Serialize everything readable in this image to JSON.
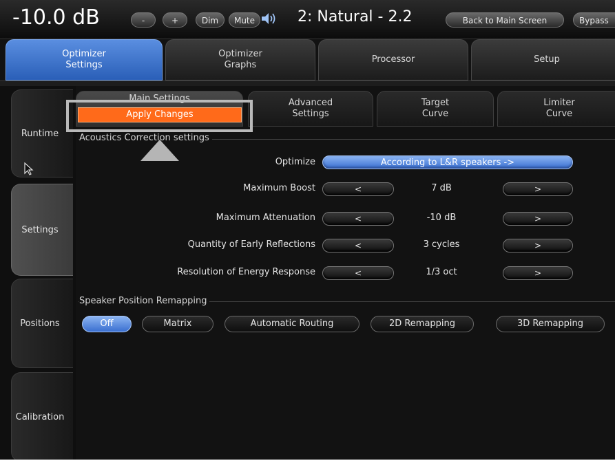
{
  "topbar": {
    "volume": "-10.0 dB",
    "minus_label": "-",
    "plus_label": "+",
    "dim_label": "Dim",
    "mute_label": "Mute",
    "speaker_icon": "speaker-volume-icon",
    "preset": "2: Natural - 2.2",
    "back_label": "Back to Main Screen",
    "bypass_label": "Bypass"
  },
  "tabs": [
    {
      "line1": "Optimizer",
      "line2": "Settings",
      "active": true
    },
    {
      "line1": "Optimizer",
      "line2": "Graphs"
    },
    {
      "line1": "Processor",
      "line2": ""
    },
    {
      "line1": "Setup",
      "line2": ""
    }
  ],
  "sidebar": {
    "items": [
      {
        "label": "Runtime"
      },
      {
        "label": "Settings",
        "active": true
      },
      {
        "label": "Positions"
      },
      {
        "label": "Calibration"
      }
    ]
  },
  "subtabs": [
    {
      "line1": "Main Settings",
      "line2": "",
      "active": true
    },
    {
      "line1": "Advanced",
      "line2": "Settings"
    },
    {
      "line1": "Target",
      "line2": "Curve"
    },
    {
      "line1": "Limiter",
      "line2": "Curve"
    }
  ],
  "apply_changes_label": "Apply Changes",
  "acoustics": {
    "group_label": "Acoustics Correction settings",
    "optimize_label": "Optimize",
    "optimize_value": "According to L&R speakers ->",
    "rows": [
      {
        "label": "Maximum Boost",
        "left": "<",
        "value": "7 dB",
        "right": ">"
      },
      {
        "label": "Maximum Attenuation",
        "left": "<",
        "value": "-10 dB",
        "right": ">"
      },
      {
        "label": "Quantity of Early Reflections",
        "left": "<",
        "value": "3 cycles",
        "right": ">"
      },
      {
        "label": "Resolution of Energy Response",
        "left": "<",
        "value": "1/3 oct",
        "right": ">"
      }
    ]
  },
  "remapping": {
    "group_label": "Speaker Position Remapping",
    "options": [
      {
        "label": "Off",
        "active": true
      },
      {
        "label": "Matrix"
      },
      {
        "label": "Automatic Routing"
      },
      {
        "label": "2D Remapping"
      },
      {
        "label": "3D Remapping"
      }
    ]
  },
  "colors": {
    "accent_blue": "#3a6fd0",
    "apply_orange": "#ff6a1a",
    "background": "#0f0f0f"
  }
}
